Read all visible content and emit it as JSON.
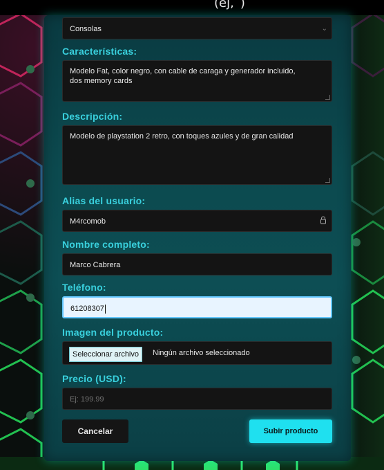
{
  "header": {
    "partial_text": "(éj,´)"
  },
  "form": {
    "category": {
      "value": "Consolas"
    },
    "features": {
      "label": "Características:",
      "value_line1": "Modelo Fat, color negro, con cable de caraga y generador incluido,",
      "value_line2": "dos memory cards"
    },
    "description": {
      "label": "Descripción:",
      "value": "Modelo de playstation 2 retro, con toques azules y de gran calidad"
    },
    "alias": {
      "label": "Alias del usuario:",
      "value": "M4rcomob"
    },
    "full_name": {
      "label": "Nombre completo:",
      "value": "Marco Cabrera"
    },
    "phone": {
      "label": "Teléfono:",
      "value": "61208307"
    },
    "image": {
      "label": "Imagen del producto:",
      "button_label": "Seleccionar archivo",
      "status": "Ningún archivo seleccionado"
    },
    "price": {
      "label": "Precio (USD):",
      "placeholder": "Ej: 199.99"
    },
    "cancel_label": "Cancelar",
    "submit_label": "Subir producto"
  },
  "colors": {
    "accent": "#39d0dd",
    "submit": "#1fe0ef",
    "panel": "#0c4a4f",
    "field": "#141414"
  }
}
